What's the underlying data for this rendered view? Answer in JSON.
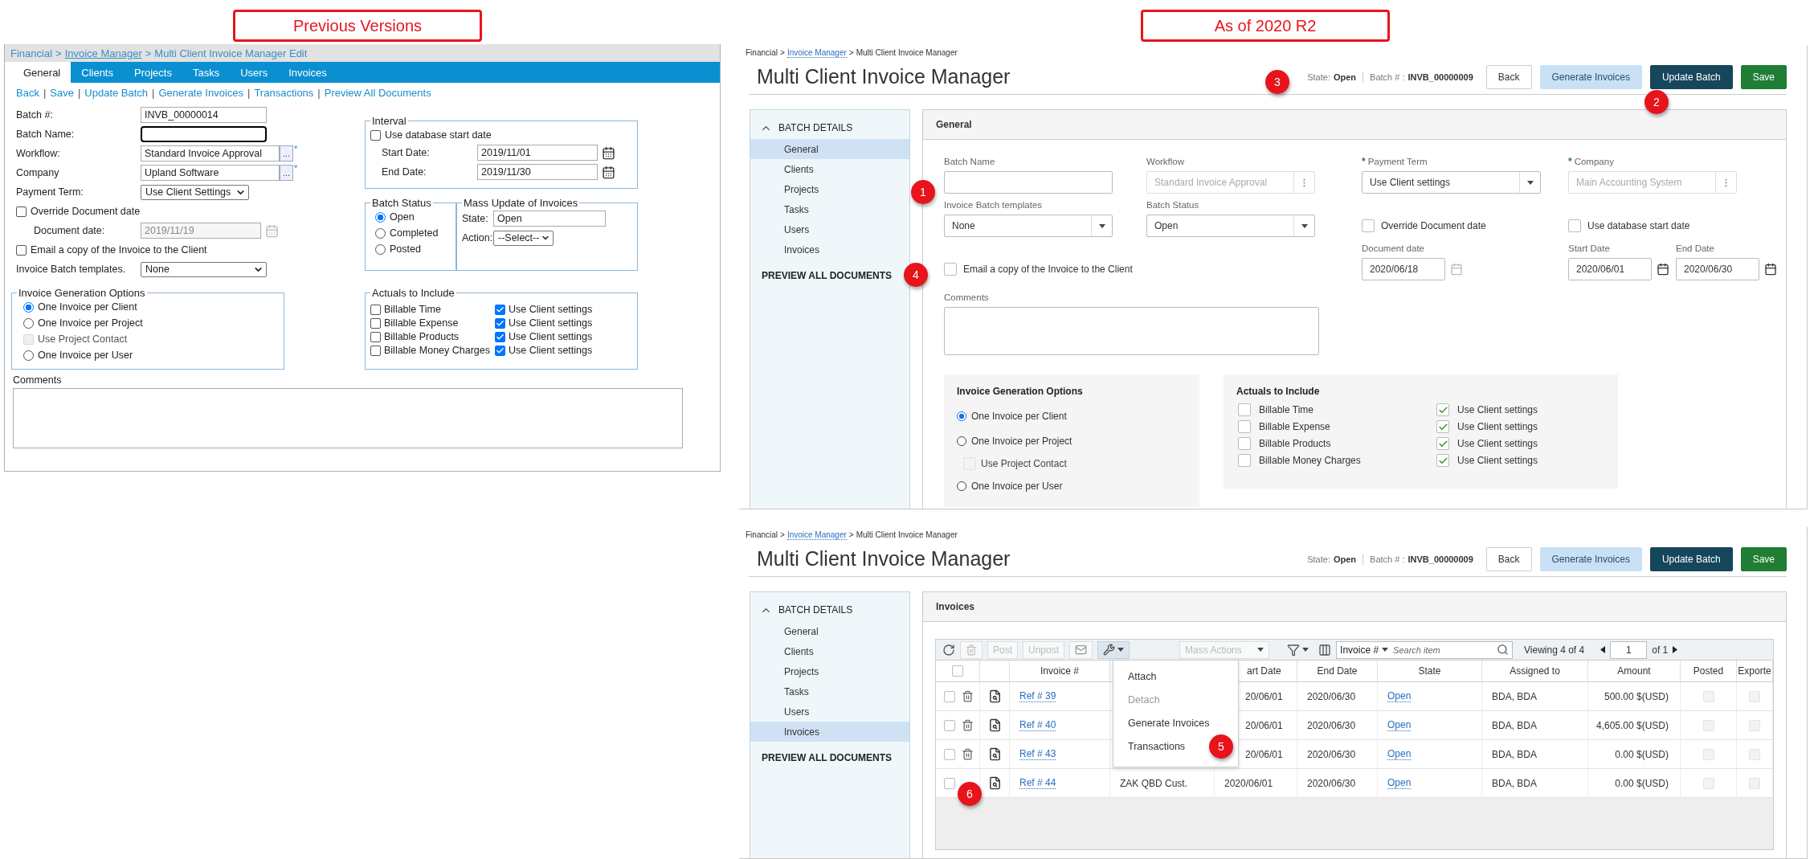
{
  "legacy": {
    "caption": "Previous Versions",
    "separator": ">",
    "breadcrumb": [
      {
        "text": "Financial",
        "link": false
      },
      {
        "text": "Invoice Manager",
        "link": true
      },
      {
        "text": "Multi Client Invoice Manager Edit",
        "link": false
      }
    ],
    "tabs": [
      {
        "label": "General",
        "selected": true
      },
      {
        "label": "Clients",
        "selected": false
      },
      {
        "label": "Projects",
        "selected": false
      },
      {
        "label": "Tasks",
        "selected": false
      },
      {
        "label": "Users",
        "selected": false
      },
      {
        "label": "Invoices",
        "selected": false
      }
    ],
    "action_separator": "|",
    "actions": [
      "Back",
      "Save",
      "Update Batch",
      "Generate Invoices",
      "Transactions",
      "Preview All Documents"
    ],
    "fields": [
      {
        "kind": "text",
        "label": "Batch #:",
        "value": "INVB_00000014",
        "focused": false
      },
      {
        "kind": "text",
        "label": "Batch Name:",
        "focused": true
      },
      {
        "kind": "lookup",
        "label": "Workflow:",
        "value": "Standard Invoice Approval",
        "button": "...",
        "required_mark": "*"
      },
      {
        "kind": "lookup",
        "label": "Company",
        "value": "Upland Software",
        "button": "...",
        "required_mark": "*"
      },
      {
        "kind": "select",
        "label": "Payment Term:",
        "value": "Use Client Settings"
      },
      {
        "kind": "checkbox",
        "label": "Override Document date",
        "checked": false
      },
      {
        "kind": "date",
        "label": "Document date:",
        "value": "2019/11/19",
        "disabled": true
      },
      {
        "kind": "checkbox",
        "label": "Email a copy of the Invoice to the Client",
        "checked": false
      },
      {
        "kind": "select",
        "label": "Invoice Batch templates.",
        "value": "None"
      }
    ],
    "generation": {
      "legend": "Invoice Generation Options",
      "options": [
        {
          "kind": "radio",
          "label": "One Invoice per Client",
          "selected": true
        },
        {
          "kind": "radio",
          "label": "One Invoice per Project",
          "selected": false
        },
        {
          "kind": "checkbox",
          "label": "Use Project Contact",
          "checked": false,
          "disabled": true
        },
        {
          "kind": "radio",
          "label": "One Invoice per User",
          "selected": false
        }
      ]
    },
    "comments_label": "Comments",
    "interval": {
      "legend": "Interval",
      "checkbox": {
        "label": "Use database start date",
        "checked": false
      },
      "dates": [
        {
          "label": "Start Date:",
          "value": "2019/11/01"
        },
        {
          "label": "End Date:",
          "value": "2019/11/30"
        }
      ]
    },
    "batch_status": {
      "legend": "Batch Status",
      "options": [
        {
          "label": "Open",
          "selected": true
        },
        {
          "label": "Completed",
          "selected": false
        },
        {
          "label": "Posted",
          "selected": false
        }
      ]
    },
    "mass_update": {
      "legend": "Mass Update of Invoices",
      "state_label": "State:",
      "state_value": "Open",
      "action_label": "Action:",
      "action_value": "--Select--"
    },
    "actuals": {
      "legend": "Actuals to Include",
      "rows": [
        {
          "label": "Billable Time",
          "checked": false,
          "setting_label": "Use Client settings",
          "setting_checked": true
        },
        {
          "label": "Billable Expense",
          "checked": false,
          "setting_label": "Use Client settings",
          "setting_checked": true
        },
        {
          "label": "Billable Products",
          "checked": false,
          "setting_label": "Use Client settings",
          "setting_checked": true
        },
        {
          "label": "Billable Money Charges",
          "checked": false,
          "setting_label": "Use Client settings",
          "setting_checked": true
        }
      ]
    }
  },
  "current": {
    "caption": "As of 2020 R2",
    "screens": [
      {
        "kind": "general",
        "separator": ">",
        "breadcrumb": [
          {
            "text": "Financial",
            "link": false
          },
          {
            "text": "Invoice Manager",
            "link": true
          },
          {
            "text": "Multi Client Invoice Manager",
            "link": false
          }
        ],
        "title": "Multi Client Invoice Manager",
        "state_label": "State:",
        "state_value": "Open",
        "batch_label": "Batch # :",
        "batch_value": "INVB_00000009",
        "buttons": [
          {
            "kind": "default",
            "label": "Back"
          },
          {
            "kind": "light",
            "label": "Generate Invoices"
          },
          {
            "kind": "dark",
            "label": "Update Batch"
          },
          {
            "kind": "success",
            "label": "Save"
          }
        ],
        "sidebar": {
          "heading": "BATCH DETAILS",
          "expanded": true,
          "items": [
            {
              "label": "General",
              "selected": true
            },
            {
              "label": "Clients",
              "selected": false
            },
            {
              "label": "Projects",
              "selected": false
            },
            {
              "label": "Tasks",
              "selected": false
            },
            {
              "label": "Users",
              "selected": false
            },
            {
              "label": "Invoices",
              "selected": false
            }
          ],
          "footer": "PREVIEW ALL DOCUMENTS"
        },
        "panel_title": "General",
        "form": {
          "rows": [
            [
              {
                "kind": "text",
                "label": "Batch Name"
              },
              {
                "kind": "lookup",
                "label": "Workflow",
                "value": "Standard Invoice Approval",
                "disabled": true
              },
              {
                "kind": "select",
                "label": "Payment Term",
                "value": "Use Client settings",
                "required_mark": "*"
              },
              {
                "kind": "lookup",
                "label": "Company",
                "value": "Main Accounting System",
                "disabled": true,
                "required_mark": "*"
              }
            ],
            [
              {
                "kind": "select",
                "label": "Invoice Batch templates",
                "value": "None"
              },
              {
                "kind": "select",
                "label": "Batch Status",
                "value": "Open"
              },
              {
                "kind": "checkbox",
                "label": "Override Document date",
                "checked": false
              },
              {
                "kind": "checkbox",
                "label": "Use database start date",
                "checked": false
              }
            ],
            [
              {
                "kind": "checkbox",
                "label": "Email a copy of the Invoice to the Client",
                "checked": false
              },
              "",
              {
                "kind": "date",
                "label": "Document date",
                "value": "2020/06/18",
                "disabled": true
              },
              {
                "kind": "date-range",
                "dates": [
                  {
                    "label": "Start Date",
                    "value": "2020/06/01",
                    "disabled": false
                  },
                  {
                    "label": "End Date",
                    "value": "2020/06/30",
                    "disabled": false
                  }
                ]
              }
            ]
          ],
          "comments_label": "Comments",
          "generation": {
            "title": "Invoice Generation Options",
            "options": [
              {
                "kind": "radio",
                "label": "One Invoice per Client",
                "selected": true
              },
              {
                "kind": "radio",
                "label": "One Invoice per Project",
                "selected": false
              },
              {
                "kind": "checkbox",
                "label": "Use Project Contact",
                "checked": false,
                "disabled": true
              },
              {
                "kind": "radio",
                "label": "One Invoice per User",
                "selected": false
              }
            ]
          },
          "actuals": {
            "title": "Actuals to Include",
            "rows": [
              {
                "label": "Billable Time",
                "checked": false,
                "setting_label": "Use Client settings",
                "setting_checked": true
              },
              {
                "label": "Billable Expense",
                "checked": false,
                "setting_label": "Use Client settings",
                "setting_checked": true
              },
              {
                "label": "Billable Products",
                "checked": false,
                "setting_label": "Use Client settings",
                "setting_checked": true
              },
              {
                "label": "Billable Money Charges",
                "checked": false,
                "setting_label": "Use Client settings",
                "setting_checked": true
              }
            ]
          }
        },
        "callouts": [
          "1",
          "2",
          "3",
          "4"
        ]
      },
      {
        "kind": "invoices",
        "separator": ">",
        "breadcrumb": [
          {
            "text": "Financial",
            "link": false
          },
          {
            "text": "Invoice Manager",
            "link": true
          },
          {
            "text": "Multi Client Invoice Manager",
            "link": false
          }
        ],
        "title": "Multi Client Invoice Manager",
        "state_label": "State:",
        "state_value": "Open",
        "batch_label": "Batch # :",
        "batch_value": "INVB_00000009",
        "buttons": [
          {
            "kind": "default",
            "label": "Back"
          },
          {
            "kind": "light",
            "label": "Generate Invoices"
          },
          {
            "kind": "dark",
            "label": "Update Batch"
          },
          {
            "kind": "success",
            "label": "Save"
          }
        ],
        "sidebar": {
          "heading": "BATCH DETAILS",
          "expanded": true,
          "items": [
            {
              "label": "General",
              "selected": false
            },
            {
              "label": "Clients",
              "selected": false
            },
            {
              "label": "Projects",
              "selected": false
            },
            {
              "label": "Tasks",
              "selected": false
            },
            {
              "label": "Users",
              "selected": false
            },
            {
              "label": "Invoices",
              "selected": true
            }
          ],
          "footer": "PREVIEW ALL DOCUMENTS"
        },
        "panel_title": "Invoices",
        "grid": {
          "toolbar": {
            "post": {
              "label": "Post",
              "disabled": true
            },
            "unpost": {
              "label": "Unpost",
              "disabled": true
            },
            "mass_actions": {
              "label": "Mass Actions",
              "disabled": true
            },
            "search_field": "Invoice #",
            "search_placeholder": "Search item",
            "viewing": "Viewing 4 of 4",
            "page": "1",
            "page_total": "of 1",
            "menu_open": true
          },
          "menu": [
            {
              "label": "Attach",
              "disabled": false
            },
            {
              "label": "Detach",
              "disabled": true
            },
            {
              "label": "Generate Invoices",
              "disabled": false
            },
            {
              "label": "Transactions",
              "disabled": false
            }
          ],
          "select_all": false,
          "columns": [
            {
              "kind": "check"
            },
            {
              "kind": "blank"
            },
            {
              "kind": "text",
              "label": "Invoice #"
            },
            {
              "kind": "blank"
            },
            {
              "kind": "text",
              "label": "art Date"
            },
            {
              "kind": "text",
              "label": "End Date"
            },
            {
              "kind": "text",
              "label": "State"
            },
            {
              "kind": "text",
              "label": "Assigned to"
            },
            {
              "kind": "text",
              "label": "Amount"
            },
            {
              "kind": "text",
              "label": "Posted"
            },
            {
              "kind": "text",
              "label": "Exporte"
            }
          ],
          "rows": [
            {
              "checked": false,
              "deletable": true,
              "invoice": "Ref # 39",
              "start_date": "20/06/01",
              "end_date": "2020/06/30",
              "state": "Open",
              "assigned_to": "BDA, BDA",
              "amount": "500.00 $(USD)",
              "posted": false,
              "exported": false
            },
            {
              "checked": false,
              "deletable": true,
              "invoice": "Ref # 40",
              "start_date": "20/06/01",
              "end_date": "2020/06/30",
              "state": "Open",
              "assigned_to": "BDA, BDA",
              "amount": "4,605.00 $(USD)",
              "posted": false,
              "exported": false
            },
            {
              "checked": false,
              "deletable": true,
              "invoice": "Ref # 43",
              "start_date": "20/06/01",
              "end_date": "2020/06/30",
              "state": "Open",
              "assigned_to": "BDA, BDA",
              "amount": "0.00 $(USD)",
              "posted": false,
              "exported": false
            },
            {
              "checked": false,
              "deletable": false,
              "invoice": "Ref # 44",
              "column_3": "ZAK QBD Cust.",
              "start_date": "2020/06/01",
              "end_date": "2020/06/30",
              "state": "Open",
              "assigned_to": "BDA, BDA",
              "amount": "0.00 $(USD)",
              "posted": false,
              "exported": false
            }
          ]
        },
        "callouts": [
          "5",
          "6"
        ]
      }
    ]
  }
}
